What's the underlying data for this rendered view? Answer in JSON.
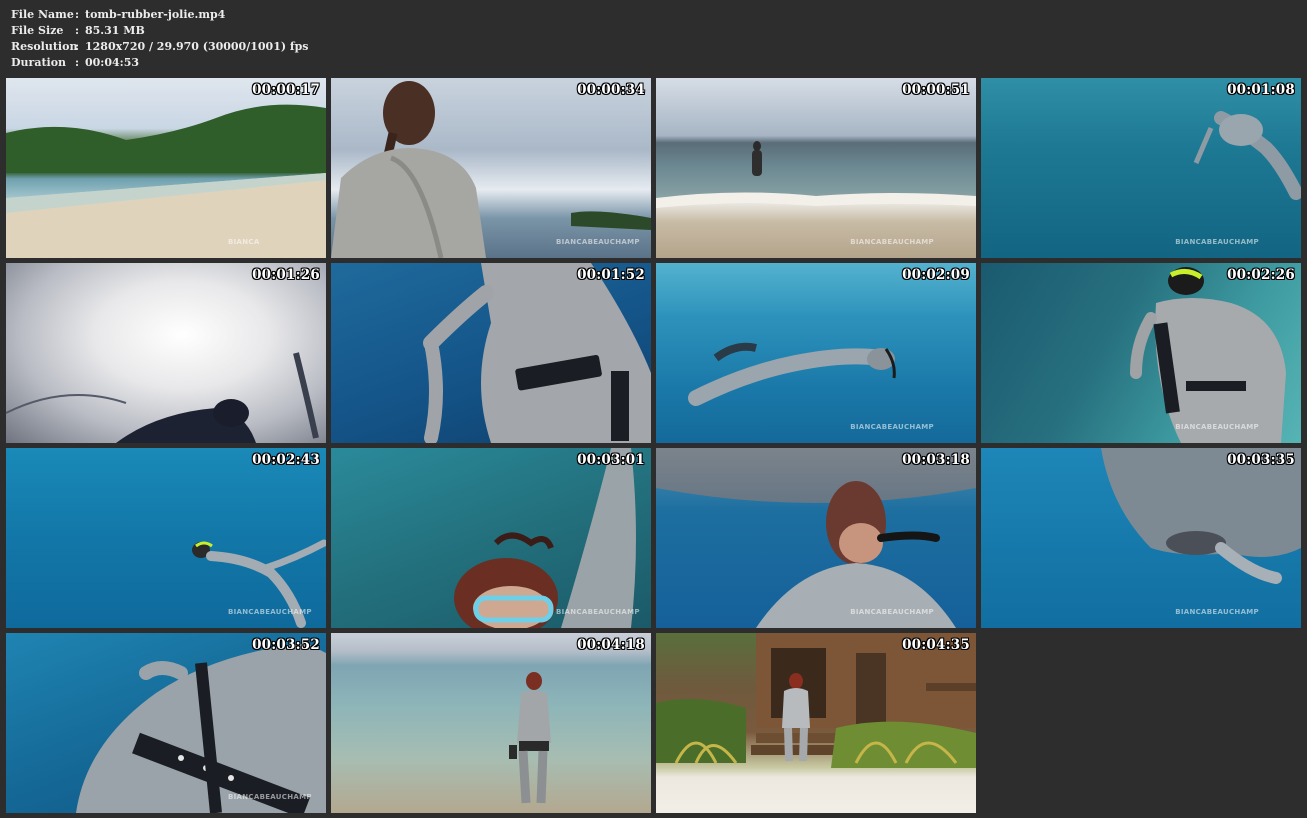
{
  "info": {
    "rows": [
      {
        "label": "File Name",
        "sep": ":",
        "value": "tomb-rubber-jolie.mp4"
      },
      {
        "label": "File Size",
        "sep": ":",
        "value": "85.31 MB"
      },
      {
        "label": "Resolution",
        "sep": ":",
        "value": "1280x720 / 29.970 (30000/1001) fps"
      },
      {
        "label": "Duration",
        "sep": ":",
        "value": "00:04:53"
      }
    ]
  },
  "thumbnails": [
    {
      "timestamp": "00:00:17",
      "watermark": "BIANCA"
    },
    {
      "timestamp": "00:00:34",
      "watermark": "BIANCABEAUCHAMP"
    },
    {
      "timestamp": "00:00:51",
      "watermark": "BIANCABEAUCHAMP"
    },
    {
      "timestamp": "00:01:08",
      "watermark": "BIANCABEAUCHAMP"
    },
    {
      "timestamp": "00:01:26",
      "watermark": ""
    },
    {
      "timestamp": "00:01:52",
      "watermark": ""
    },
    {
      "timestamp": "00:02:09",
      "watermark": "BIANCABEAUCHAMP"
    },
    {
      "timestamp": "00:02:26",
      "watermark": "BIANCABEAUCHAMP"
    },
    {
      "timestamp": "00:02:43",
      "watermark": "BIANCABEAUCHAMP"
    },
    {
      "timestamp": "00:03:01",
      "watermark": "BIANCABEAUCHAMP"
    },
    {
      "timestamp": "00:03:18",
      "watermark": "BIANCABEAUCHAMP"
    },
    {
      "timestamp": "00:03:35",
      "watermark": "BIANCABEAUCHAMP"
    },
    {
      "timestamp": "00:03:52",
      "watermark": "BIANCABEAUCHAMP"
    },
    {
      "timestamp": "00:04:18",
      "watermark": ""
    },
    {
      "timestamp": "00:04:35",
      "watermark": ""
    }
  ],
  "colors": {
    "background": "#2d2d2d",
    "text": "#ececec"
  }
}
